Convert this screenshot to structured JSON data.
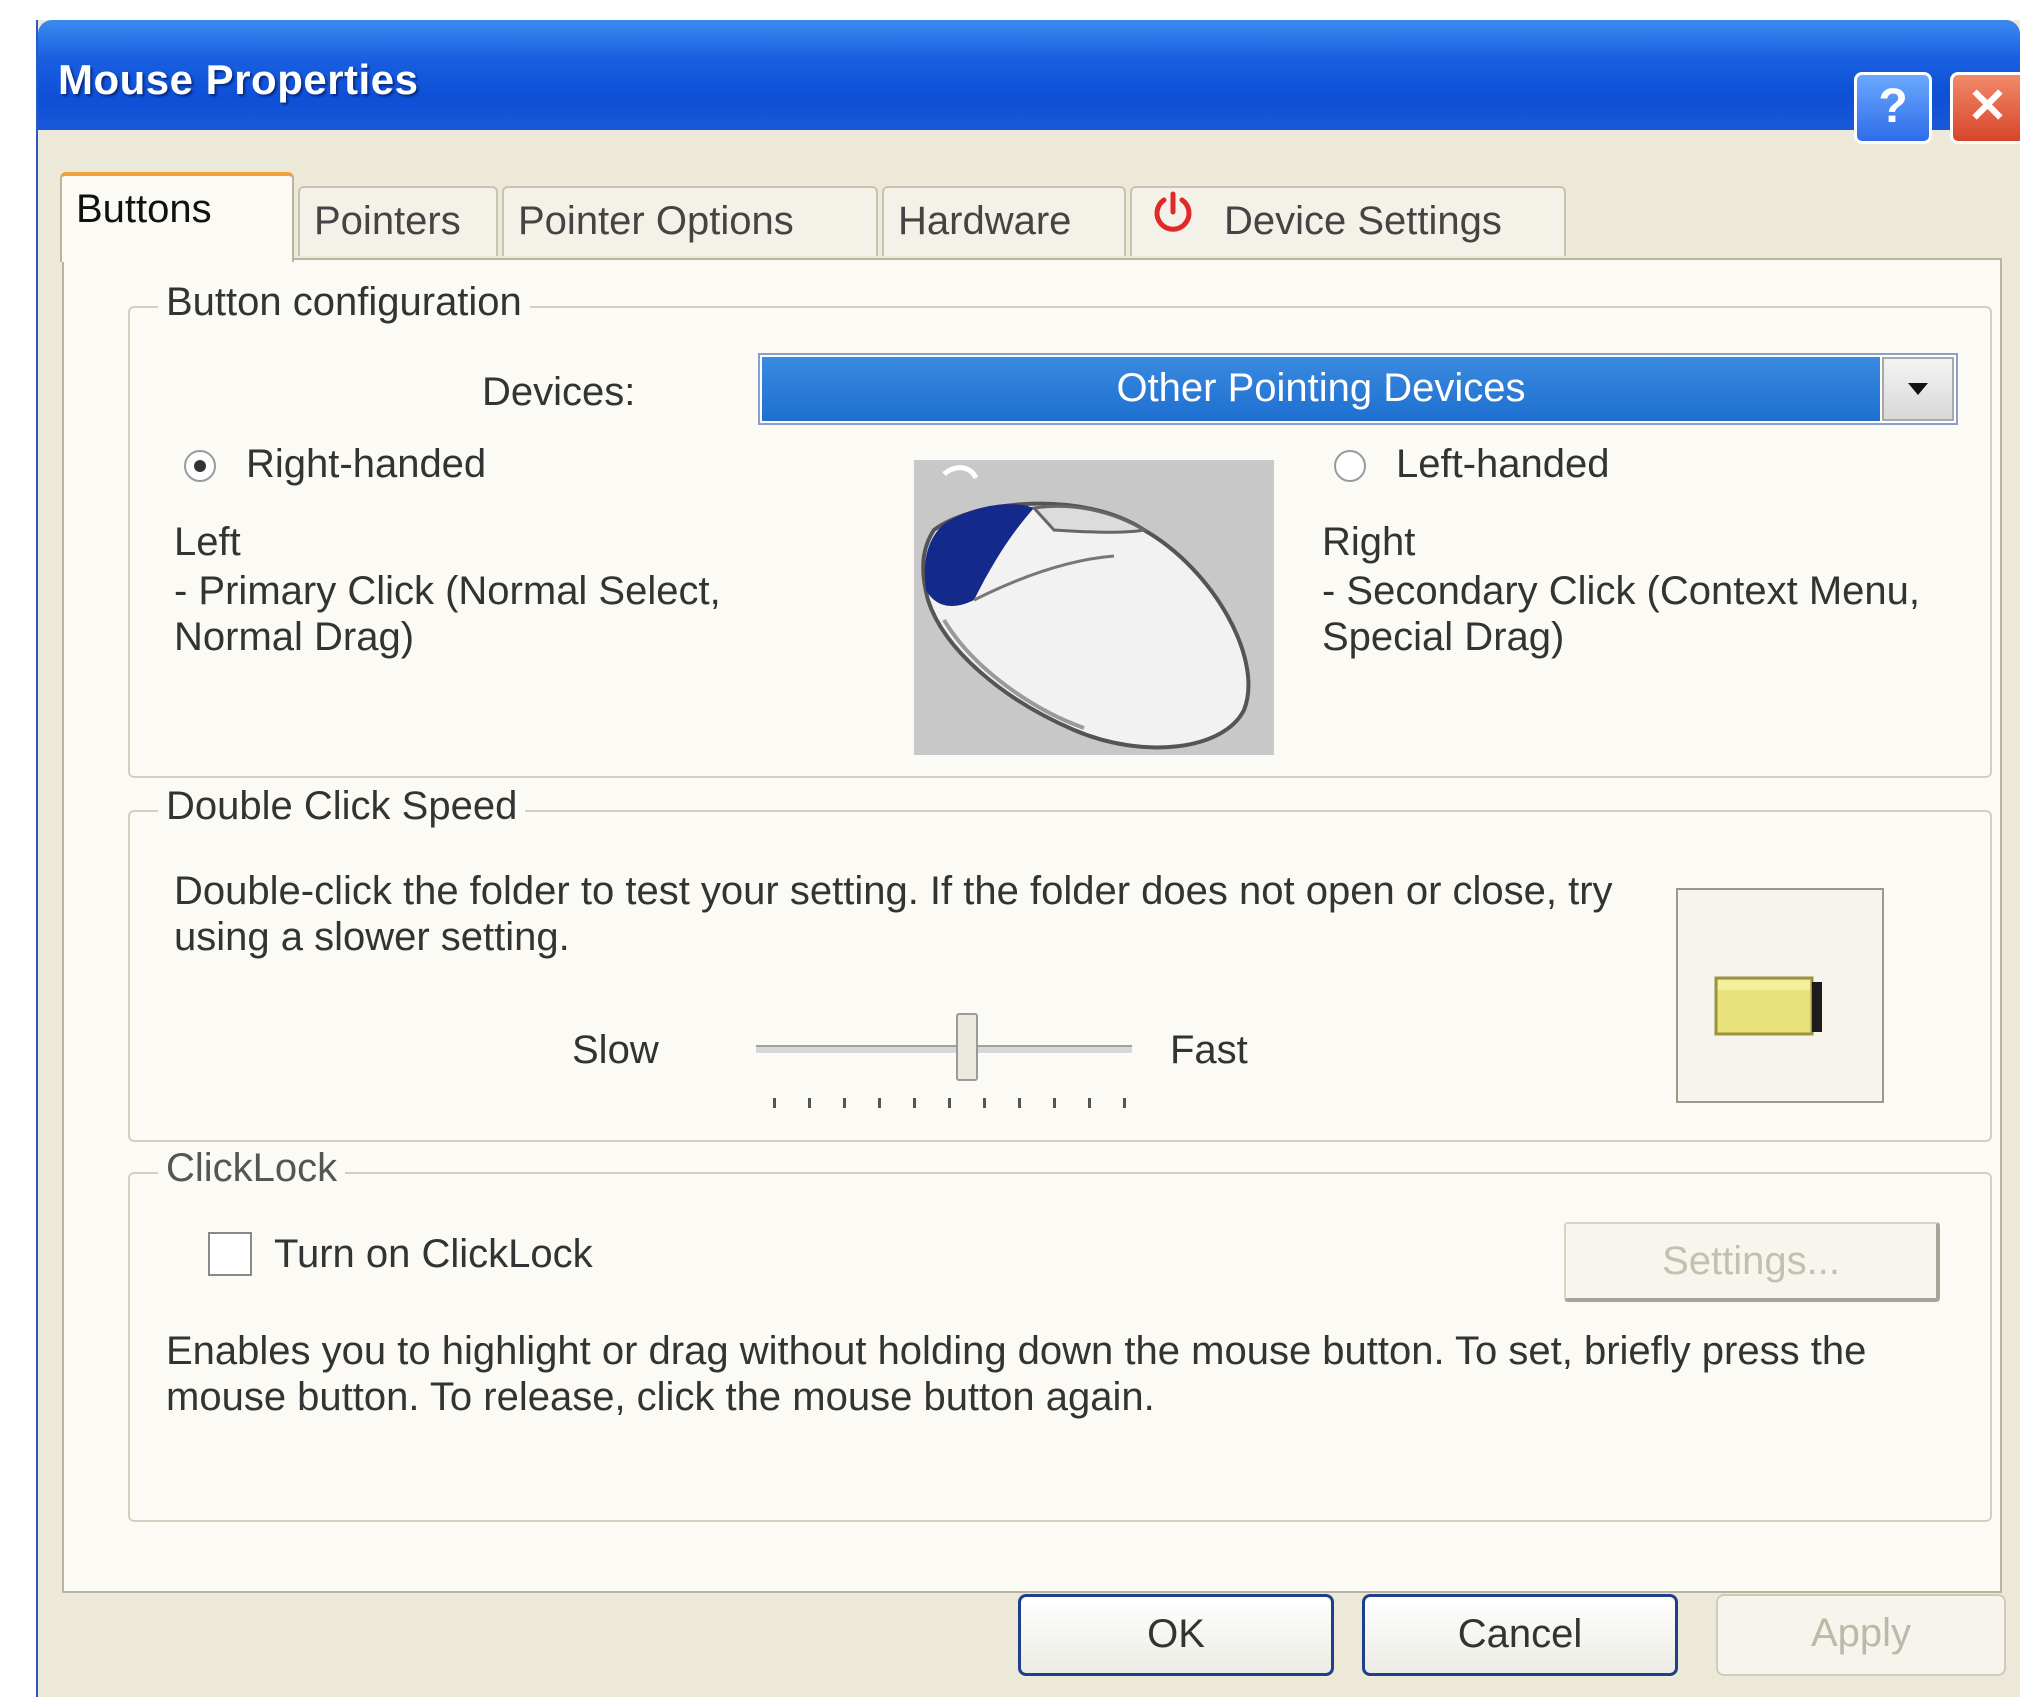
{
  "window": {
    "title": "Mouse Properties",
    "help_glyph": "?",
    "close_glyph": "✕"
  },
  "tabs": [
    {
      "label": "Buttons",
      "active": true
    },
    {
      "label": "Pointers",
      "active": false
    },
    {
      "label": "Pointer Options",
      "active": false
    },
    {
      "label": "Hardware",
      "active": false
    },
    {
      "label": "Device Settings",
      "active": false,
      "icon": "power-icon"
    }
  ],
  "button_config": {
    "group_label": "Button configuration",
    "devices_label": "Devices:",
    "devices_value": "Other Pointing Devices",
    "right_handed_label": "Right-handed",
    "right_handed_selected": true,
    "left_handed_label": "Left-handed",
    "left_handed_selected": false,
    "left_title": "Left",
    "left_desc": "- Primary Click (Normal Select, Normal Drag)",
    "right_title": "Right",
    "right_desc": "- Secondary Click (Context Menu, Special Drag)",
    "image_icon": "mouse-icon"
  },
  "double_click": {
    "group_label": "Double Click Speed",
    "description": "Double-click the folder to test your setting.  If the folder does not open or close, try using a slower setting.",
    "slow_label": "Slow",
    "fast_label": "Fast",
    "slider_position": 0.56,
    "tick_count": 11,
    "folder_icon": "folder-icon"
  },
  "clicklock": {
    "group_label": "ClickLock",
    "checkbox_label": "Turn on ClickLock",
    "checked": false,
    "settings_label": "Settings...",
    "description": "Enables you to highlight or drag without holding down the mouse button.  To set, briefly press the mouse button.  To release, click the mouse button again."
  },
  "footer": {
    "ok_label": "OK",
    "cancel_label": "Cancel",
    "apply_label": "Apply"
  },
  "colors": {
    "titlebar": "#0d4fd6",
    "selection": "#1e6fd0",
    "window_bg": "#ece9d8",
    "tab_accent": "#f0a23a"
  }
}
